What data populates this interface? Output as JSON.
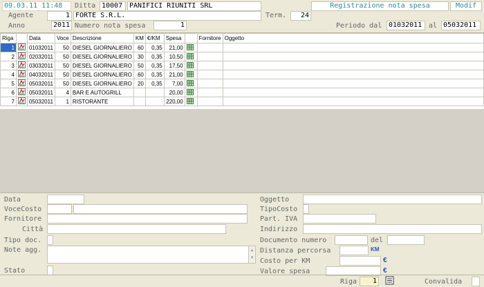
{
  "header": {
    "datetime": "09.03.11 11:48",
    "ditta_label": "Ditta",
    "ditta_code": "10007",
    "ditta_name": "PANIFICI RIUNITI SRL",
    "title": "Registrazione nota spesa",
    "mode": "Modif",
    "agente_label": "Agente",
    "agente_code": "1",
    "agente_name": "FORTE S.R.L.",
    "term_label": "Term.",
    "term_value": "24",
    "anno_label": "Anno",
    "anno_value": "2011",
    "numero_label": "Numero nota spesa",
    "numero_value": "1",
    "periodo_label": "Periodo dal",
    "periodo_dal": "01032011",
    "al_label": "al",
    "periodo_al": "05032011"
  },
  "grid": {
    "columns": [
      "Riga",
      "",
      "Data",
      "Voce",
      "Descrizione",
      "KM",
      "€/KM",
      "Spesa",
      "",
      "Fornitore",
      "Oggetto"
    ],
    "rows": [
      {
        "riga": "1",
        "data": "01032011",
        "voce": "50",
        "descrizione": "DIESEL GIORNALIERO",
        "km": "60",
        "eur_km": "0,35",
        "spesa": "21,00"
      },
      {
        "riga": "2",
        "data": "02032011",
        "voce": "50",
        "descrizione": "DIESEL GIORNALIERO",
        "km": "30",
        "eur_km": "0,35",
        "spesa": "10,50"
      },
      {
        "riga": "3",
        "data": "03032011",
        "voce": "50",
        "descrizione": "DIESEL GIORNALIERO",
        "km": "50",
        "eur_km": "0,35",
        "spesa": "17,50"
      },
      {
        "riga": "4",
        "data": "04032011",
        "voce": "50",
        "descrizione": "DIESEL GIORNALIERO",
        "km": "60",
        "eur_km": "0,35",
        "spesa": "21,00"
      },
      {
        "riga": "5",
        "data": "05032011",
        "voce": "50",
        "descrizione": "DIESEL GIORNALIERO",
        "km": "20",
        "eur_km": "0,35",
        "spesa": "7,00"
      },
      {
        "riga": "6",
        "data": "05032011",
        "voce": "4",
        "descrizione": "BAR E AUTOGRILL",
        "km": "",
        "eur_km": "",
        "spesa": "20,00"
      },
      {
        "riga": "7",
        "data": "05032011",
        "voce": "1",
        "descrizione": "RISTORANTE",
        "km": "",
        "eur_km": "",
        "spesa": "220,00"
      }
    ]
  },
  "form": {
    "data_label": "Data",
    "vocecosto_label": "VoceCosto",
    "fornitore_label": "Fornitore",
    "citta_label": "Città",
    "tipodoc_label": "Tipo doc.",
    "noteagg_label": "Note agg.",
    "stato_label": "Stato",
    "oggetto_label": "Oggetto",
    "tipocosto_label": "TipoCosto",
    "partiva_label": "Part. IVA",
    "indirizzo_label": "Indirizzo",
    "documento_label": "Documento numero",
    "del_label": "del",
    "distanza_label": "Distanza percorsa",
    "km_unit": "KM",
    "costokm_label": "Costo per KM",
    "euro1": "€",
    "valore_label": "Valore spesa",
    "euro2": "€",
    "riga_label": "Riga",
    "riga_value": "1",
    "convalida_label": "Convalida"
  }
}
